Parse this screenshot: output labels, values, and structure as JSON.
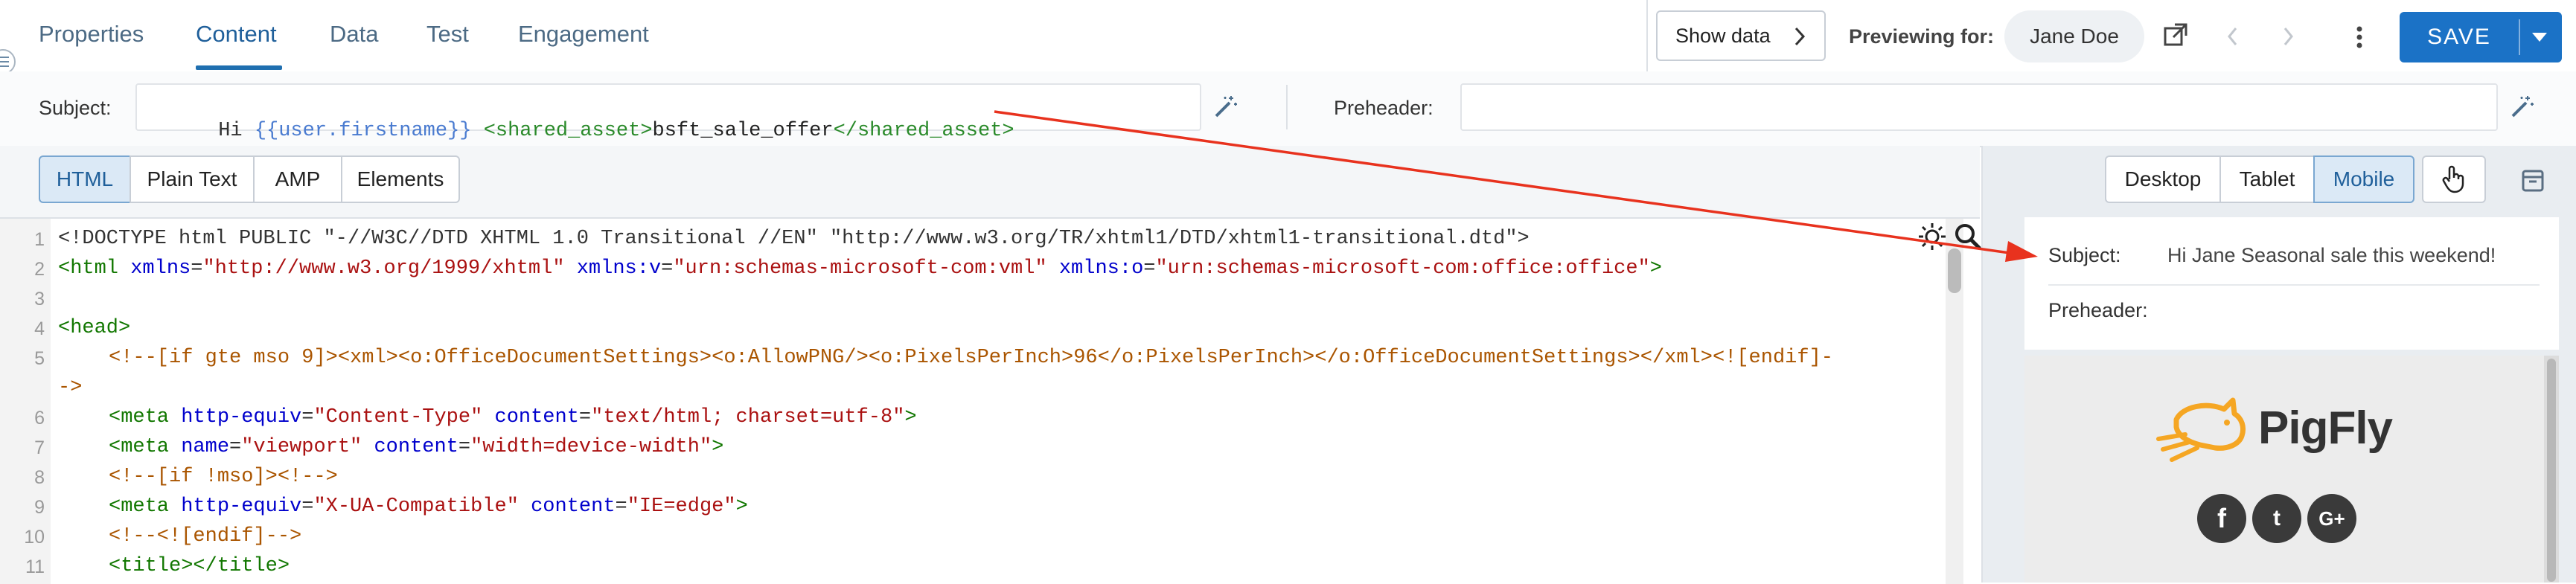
{
  "tabs": [
    {
      "label": "Properties"
    },
    {
      "label": "Content"
    },
    {
      "label": "Data"
    },
    {
      "label": "Test"
    },
    {
      "label": "Engagement"
    }
  ],
  "header": {
    "show_data": "Show data",
    "previewing_for": "Previewing for:",
    "user": "Jane Doe",
    "save": "SAVE"
  },
  "subject": {
    "label": "Subject:",
    "value_parts": {
      "hi": "Hi ",
      "var": "{{user.firstname}}",
      "open": "<shared_asset>",
      "asset": "bsft_sale_offer",
      "close": "</shared_asset>"
    }
  },
  "preheader": {
    "label": "Preheader:",
    "value": ""
  },
  "editor_modes": [
    "HTML",
    "Plain Text",
    "AMP",
    "Elements"
  ],
  "device_modes": [
    "Desktop",
    "Tablet",
    "Mobile"
  ],
  "code_lines": [
    {
      "n": "1"
    },
    {
      "n": "2"
    },
    {
      "n": "3"
    },
    {
      "n": "4"
    },
    {
      "n": "5"
    },
    {
      "n": ""
    },
    {
      "n": "6"
    },
    {
      "n": "7"
    },
    {
      "n": "8"
    },
    {
      "n": "9"
    },
    {
      "n": "10"
    },
    {
      "n": "11"
    }
  ],
  "code": {
    "l1": "<!DOCTYPE html PUBLIC \"-//W3C//DTD XHTML 1.0 Transitional //EN\" \"http://www.w3.org/TR/xhtml1/DTD/xhtml1-transitional.dtd\">",
    "l5": "<!--[if gte mso 9]><xml><o:OfficeDocumentSettings><o:AllowPNG/><o:PixelsPerInch>96</o:PixelsPerInch></o:OfficeDocumentSettings></xml><![endif]-",
    "l5b": "->",
    "l8": "<!--[if !mso]><!-->",
    "l10": "<!--<![endif]-->",
    "l11": "<title></title>"
  },
  "preview": {
    "subject_label": "Subject:",
    "subject_value": "Hi Jane Seasonal sale this weekend!",
    "preheader_label": "Preheader:",
    "brand": "PigFly",
    "social": [
      "f",
      "t",
      "G+"
    ]
  },
  "colors": {
    "accent": "#1b72c6",
    "annotation_arrow": "#e8321e",
    "brand_orange": "#f5a623"
  }
}
